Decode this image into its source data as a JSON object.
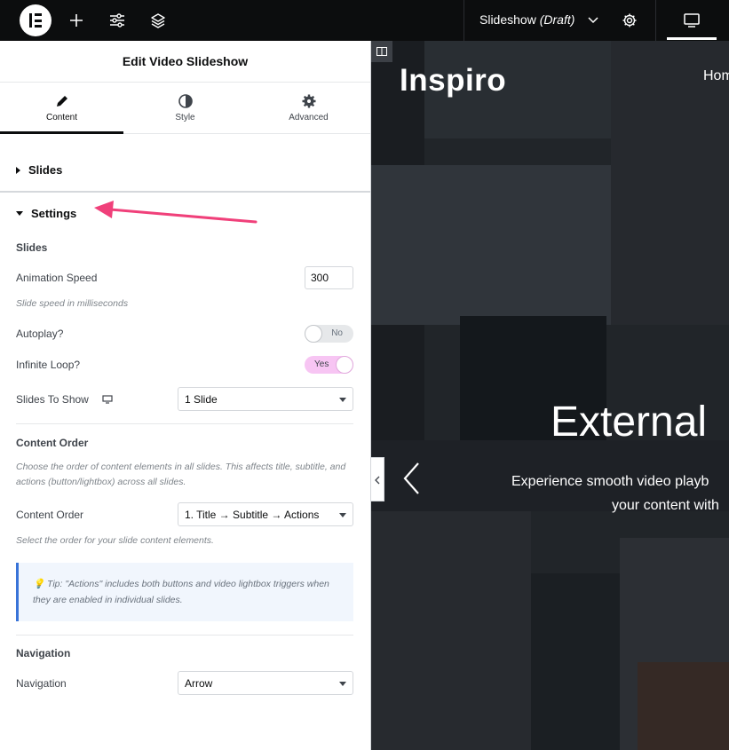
{
  "topbar": {
    "doc_title": "Slideshow",
    "doc_status": "(Draft)",
    "icons": [
      "elementor-logo-icon",
      "add-icon",
      "sliders-icon",
      "layers-icon",
      "chevron-down-icon",
      "settings-gear-icon",
      "desktop-icon"
    ]
  },
  "panel": {
    "title": "Edit Video Slideshow",
    "tabs": [
      {
        "label": "Content",
        "icon": "pencil-icon",
        "active": true
      },
      {
        "label": "Style",
        "icon": "half-circle-icon",
        "active": false
      },
      {
        "label": "Advanced",
        "icon": "gear-icon",
        "active": false
      }
    ],
    "sections": {
      "slides_label": "Slides",
      "settings_label": "Settings"
    },
    "settings": {
      "slides_heading": "Slides",
      "animation_speed_label": "Animation Speed",
      "animation_speed_value": "300",
      "animation_speed_hint": "Slide speed in milliseconds",
      "autoplay_label": "Autoplay?",
      "autoplay_state": "No",
      "infinite_loop_label": "Infinite Loop?",
      "infinite_loop_state": "Yes",
      "slides_to_show_label": "Slides To Show",
      "slides_to_show_value": "1 Slide",
      "content_order_heading": "Content Order",
      "content_order_hint": "Choose the order of content elements in all slides. This affects title, subtitle, and actions (button/lightbox) across all slides.",
      "content_order_label": "Content Order",
      "content_order_value": "1. Title → Subtitle → Actions",
      "content_order_select_hint": "Select the order for your slide content elements.",
      "tip_text": "💡 Tip: \"Actions\" includes both buttons and video lightbox triggers when they are enabled in individual slides.",
      "navigation_heading": "Navigation",
      "navigation_label": "Navigation",
      "navigation_value": "Arrow"
    }
  },
  "preview": {
    "site_title": "Inspiro",
    "nav_item": "Hom",
    "hero_title": "External",
    "hero_subtitle_line1": "Experience smooth video playb",
    "hero_subtitle_line2": "your content with"
  },
  "colors": {
    "topbar_bg": "#0c0d0e",
    "toggle_on": "#f7c5f3",
    "tip_border": "#3873d8",
    "annotation_arrow": "#f0407a"
  }
}
